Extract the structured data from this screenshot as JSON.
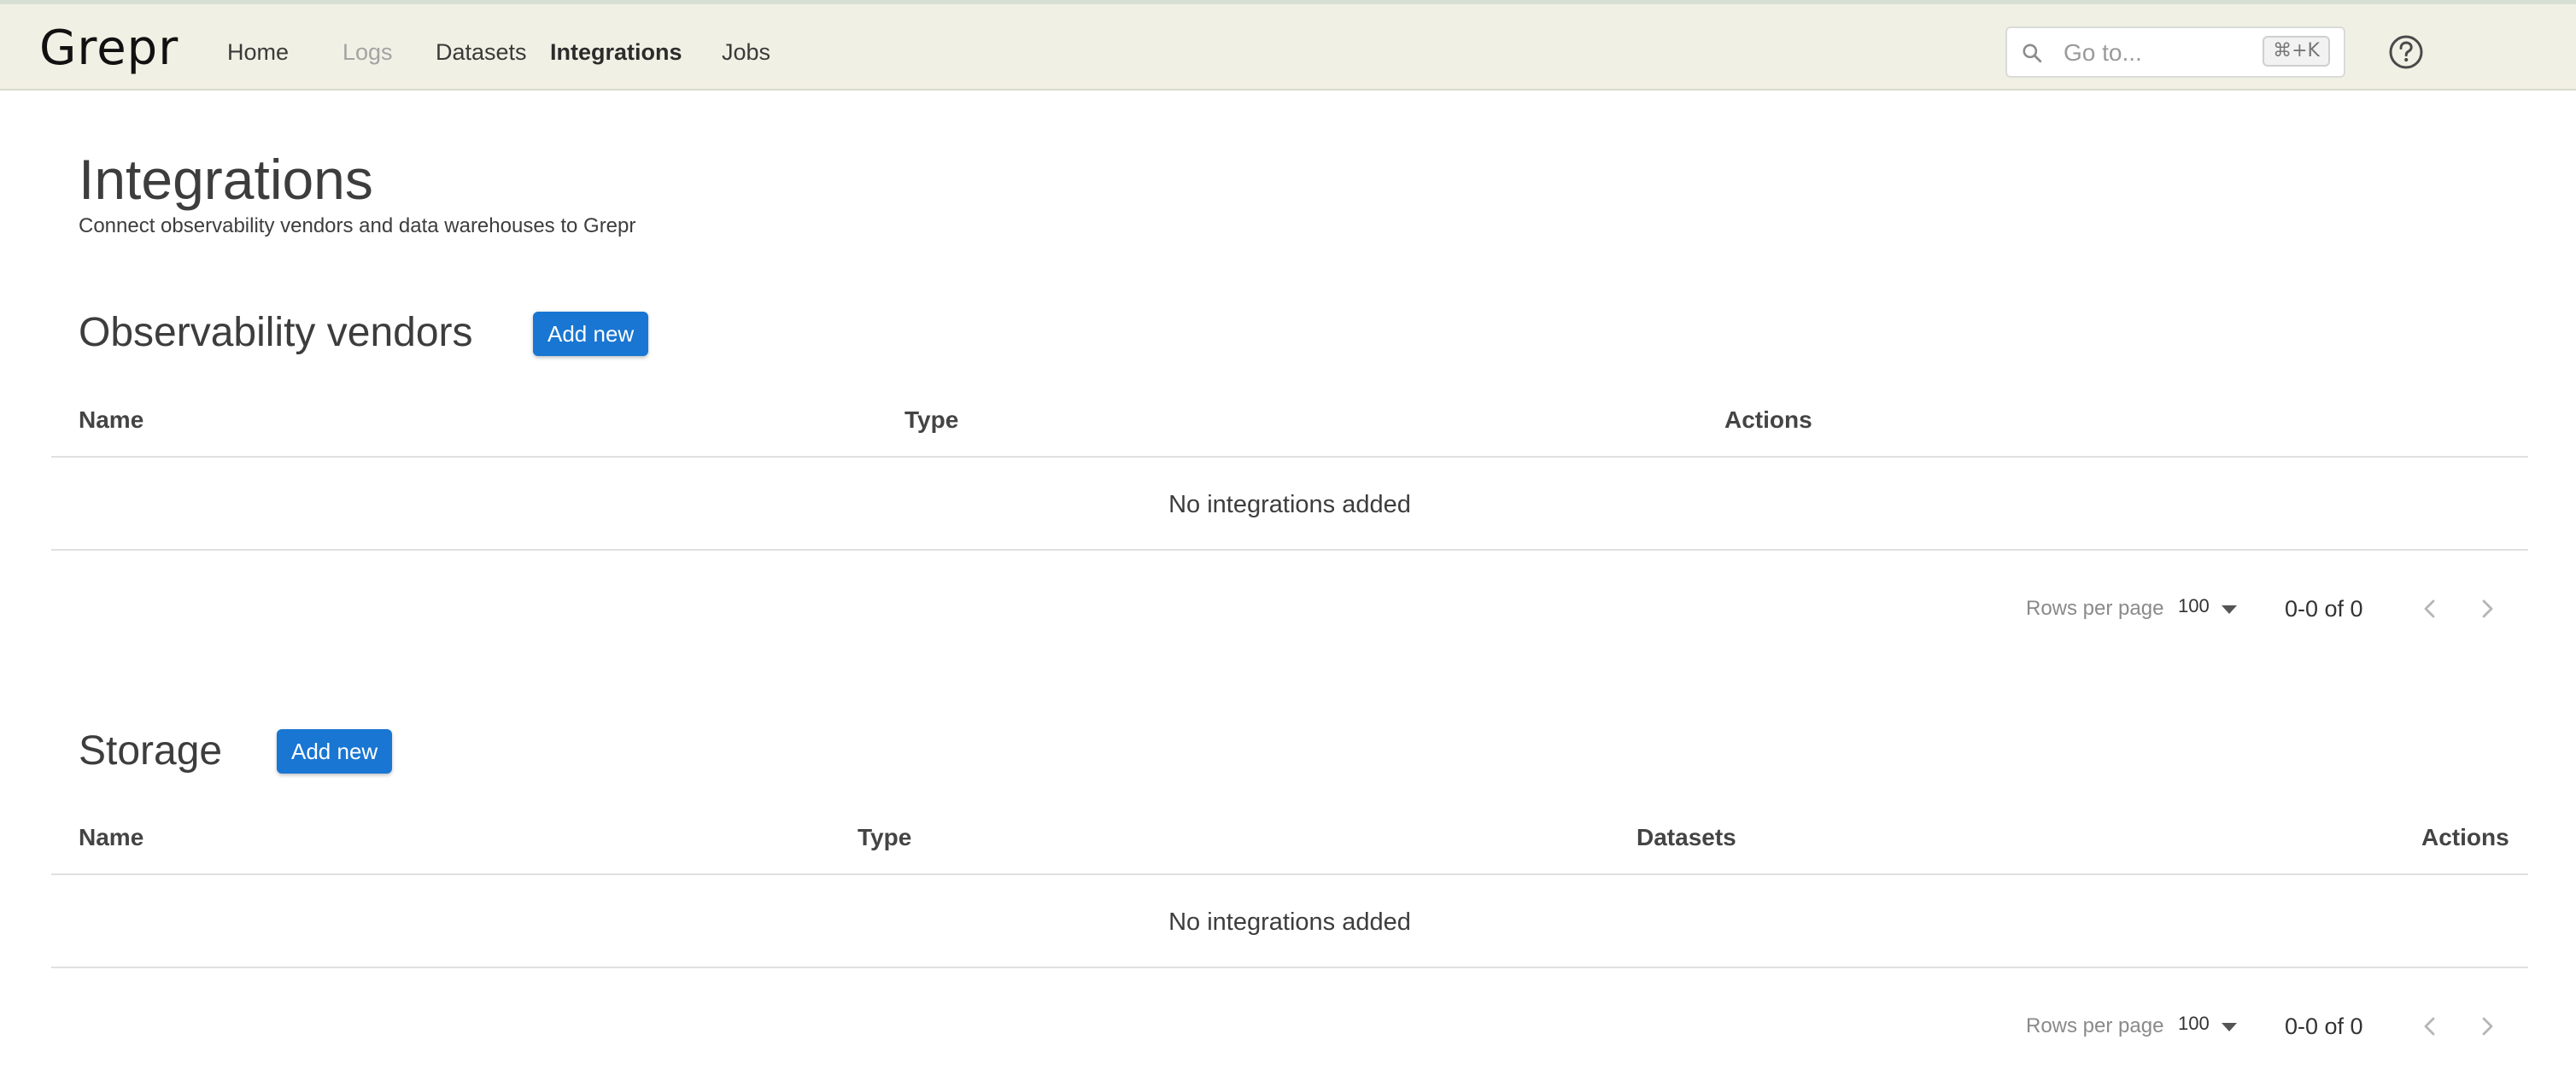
{
  "app": {
    "logo_text": "Grepr"
  },
  "nav": {
    "items": [
      {
        "label": "Home"
      },
      {
        "label": "Logs"
      },
      {
        "label": "Datasets"
      },
      {
        "label": "Integrations"
      },
      {
        "label": "Jobs"
      }
    ],
    "active": "Integrations",
    "disabled": "Logs"
  },
  "search": {
    "placeholder": "Go to...",
    "shortcut": "⌘+K"
  },
  "page": {
    "title": "Integrations",
    "subtitle": "Connect observability vendors and data warehouses to Grepr"
  },
  "observability": {
    "title": "Observability vendors",
    "add_label": "Add new",
    "columns": [
      "Name",
      "Type",
      "Actions"
    ],
    "empty_text": "No integrations added",
    "rows_per_page_label": "Rows per page",
    "rows_per_page": "100",
    "range": "0-0 of 0"
  },
  "storage": {
    "title": "Storage",
    "add_label": "Add new",
    "columns": [
      "Name",
      "Type",
      "Datasets",
      "Actions"
    ],
    "empty_text": "No integrations added",
    "rows_per_page_label": "Rows per page",
    "rows_per_page": "100",
    "range": "0-0 of 0"
  },
  "colors": {
    "accent": "#1976d2",
    "topbar_bg": "#f1f0e4"
  }
}
